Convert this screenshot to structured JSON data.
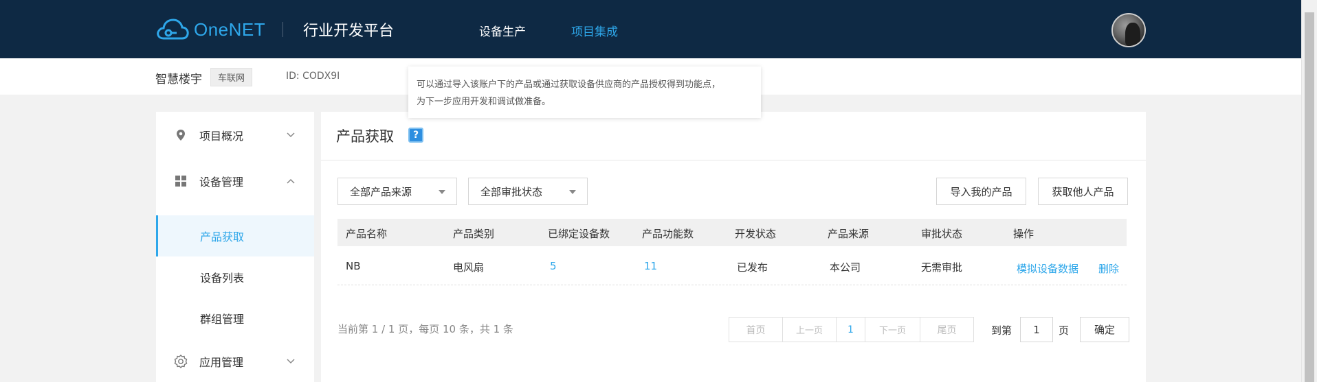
{
  "header": {
    "brand": "OneNET",
    "platform": "行业开发平台",
    "nav": [
      {
        "label": "设备生产",
        "active": false
      },
      {
        "label": "项目集成",
        "active": true
      }
    ],
    "brand_color": "#2ea7ea",
    "bg_color": "#0e2944"
  },
  "subheader": {
    "project_name": "智慧楼宇",
    "tag": "车联网",
    "id_text": "ID: CODX9I"
  },
  "tooltip": {
    "line1": "可以通过导入该账户下的产品或通过获取设备供应商的产品授权得到功能点，",
    "line2": "为下一步应用开发和调试做准备。"
  },
  "sidebar": {
    "groups": [
      {
        "label": "项目概况",
        "icon": "location-pin-icon",
        "expanded": false
      },
      {
        "label": "设备管理",
        "icon": "grid-icon",
        "expanded": true
      },
      {
        "label": "应用管理",
        "icon": "gear-icon",
        "expanded": false
      }
    ],
    "sub_items": [
      {
        "label": "产品获取",
        "active": true
      },
      {
        "label": "设备列表",
        "active": false
      },
      {
        "label": "群组管理",
        "active": false
      }
    ]
  },
  "main": {
    "title": "产品获取",
    "help_icon": "?",
    "filters": {
      "source": "全部产品来源",
      "status": "全部审批状态"
    },
    "buttons": {
      "import": "导入我的产品",
      "get_others": "获取他人产品"
    },
    "table": {
      "columns": [
        "产品名称",
        "产品类别",
        "已绑定设备数",
        "产品功能数",
        "开发状态",
        "产品来源",
        "审批状态",
        "操作"
      ],
      "rows": [
        {
          "name": "NB",
          "category": "电风扇",
          "bound_devices": "5",
          "functions": "11",
          "dev_status": "已发布",
          "source": "本公司",
          "approval": "无需审批",
          "actions": [
            "模拟设备数据",
            "删除"
          ]
        }
      ]
    },
    "pagination": {
      "info": "当前第 1 / 1 页，每页 10 条，共 1 条",
      "first": "首页",
      "prev": "上一页",
      "current": "1",
      "next": "下一页",
      "last": "尾页",
      "goto_label": "到第",
      "goto_value": "1",
      "page_suffix": "页",
      "confirm": "确定"
    }
  }
}
